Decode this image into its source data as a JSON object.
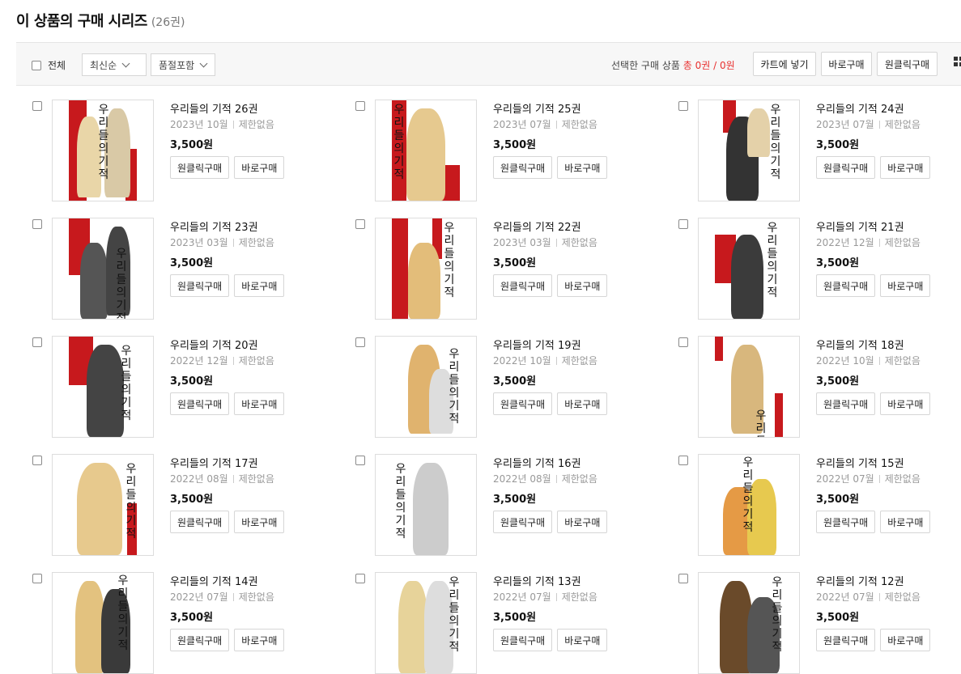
{
  "header": {
    "title": "이 상품의 구매 시리즈",
    "count": "(26권)"
  },
  "toolbar": {
    "select_all_label": "전체",
    "sort_value": "최신순",
    "filter_value": "품절포함",
    "selected_prefix": "선택한 구매 상품",
    "selected_count": "총 0권 / 0원",
    "cart_button": "카트에 넣기",
    "buy_now_button": "바로구매",
    "one_click_button": "원클릭구매",
    "view_toggle_icon": "grid-view-icon"
  },
  "item_buttons": {
    "one_click": "원클릭구매",
    "buy_now": "바로구매"
  },
  "colors": {
    "accent": "#e8302f",
    "cover_red": "#c7191d"
  },
  "items": [
    {
      "title": "우리들의 기적 26권",
      "date": "2023년 10월",
      "limit": "제한없음",
      "price": "3,500원",
      "cover_text": "우리들의 기적"
    },
    {
      "title": "우리들의 기적 25권",
      "date": "2023년 07월",
      "limit": "제한없음",
      "price": "3,500원",
      "cover_text": "우리들의 기적"
    },
    {
      "title": "우리들의 기적 24권",
      "date": "2023년 07월",
      "limit": "제한없음",
      "price": "3,500원",
      "cover_text": "우리들의 기적"
    },
    {
      "title": "우리들의 기적 23권",
      "date": "2023년 03월",
      "limit": "제한없음",
      "price": "3,500원",
      "cover_text": "우리들의 기적"
    },
    {
      "title": "우리들의 기적 22권",
      "date": "2023년 03월",
      "limit": "제한없음",
      "price": "3,500원",
      "cover_text": "우리들의 기적"
    },
    {
      "title": "우리들의 기적 21권",
      "date": "2022년 12월",
      "limit": "제한없음",
      "price": "3,500원",
      "cover_text": "우리들의 기적"
    },
    {
      "title": "우리들의 기적 20권",
      "date": "2022년 12월",
      "limit": "제한없음",
      "price": "3,500원",
      "cover_text": "우리들의 기적"
    },
    {
      "title": "우리들의 기적 19권",
      "date": "2022년 10월",
      "limit": "제한없음",
      "price": "3,500원",
      "cover_text": "우리들의 기적"
    },
    {
      "title": "우리들의 기적 18권",
      "date": "2022년 10월",
      "limit": "제한없음",
      "price": "3,500원",
      "cover_text": "우리들의 기적"
    },
    {
      "title": "우리들의 기적 17권",
      "date": "2022년 08월",
      "limit": "제한없음",
      "price": "3,500원",
      "cover_text": "우리들의 기적"
    },
    {
      "title": "우리들의 기적 16권",
      "date": "2022년 08월",
      "limit": "제한없음",
      "price": "3,500원",
      "cover_text": "우리들의 기적"
    },
    {
      "title": "우리들의 기적 15권",
      "date": "2022년 07월",
      "limit": "제한없음",
      "price": "3,500원",
      "cover_text": "우리들의 기적"
    },
    {
      "title": "우리들의 기적 14권",
      "date": "2022년 07월",
      "limit": "제한없음",
      "price": "3,500원",
      "cover_text": "우리들의 기적"
    },
    {
      "title": "우리들의 기적 13권",
      "date": "2022년 07월",
      "limit": "제한없음",
      "price": "3,500원",
      "cover_text": "우리들의 기적"
    },
    {
      "title": "우리들의 기적 12권",
      "date": "2022년 07월",
      "limit": "제한없음",
      "price": "3,500원",
      "cover_text": "우리들의 기적"
    }
  ]
}
